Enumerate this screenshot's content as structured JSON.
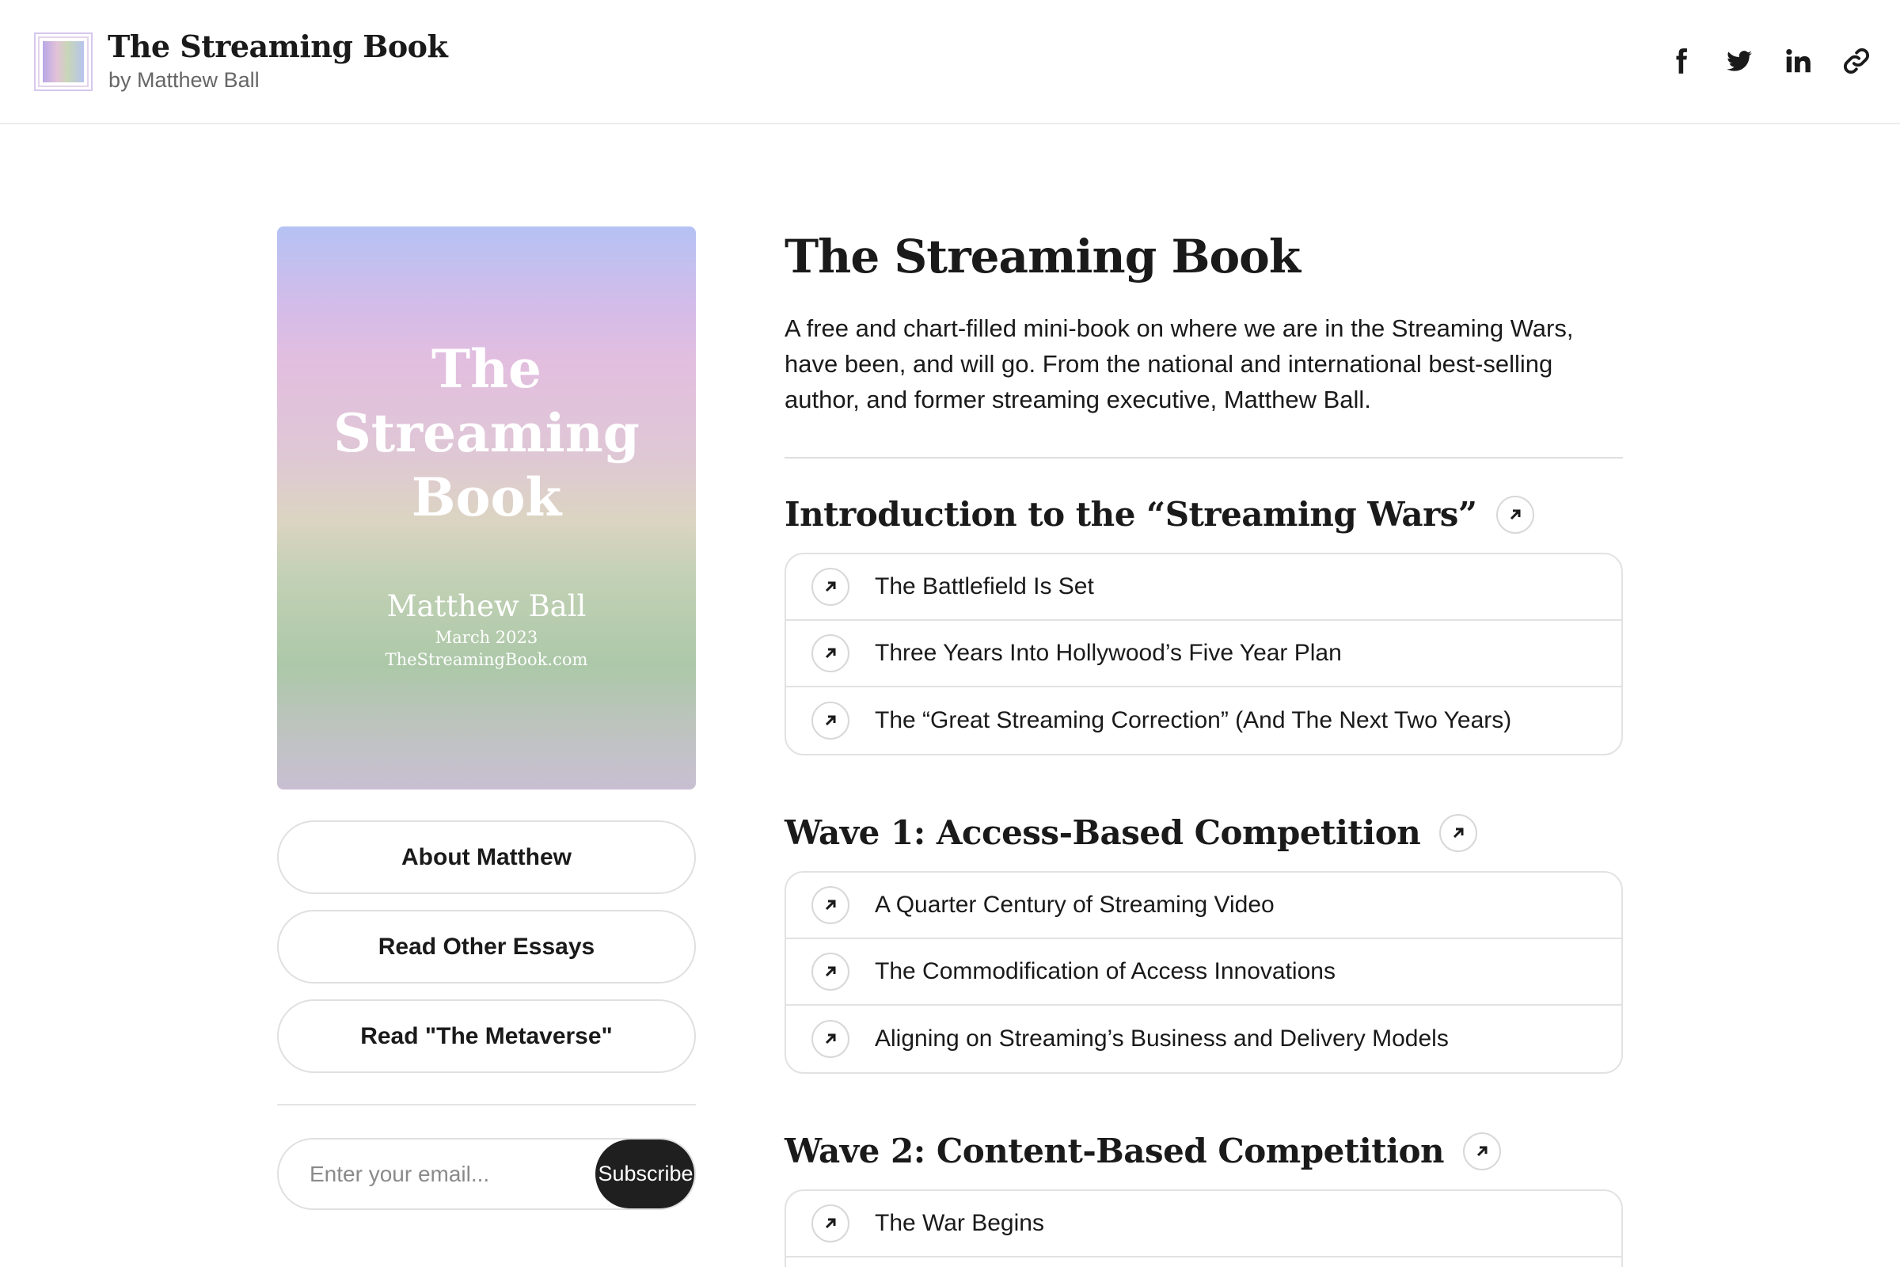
{
  "header": {
    "site_title": "The Streaming Book",
    "site_subtitle": "by Matthew Ball",
    "social_icons": [
      "facebook-icon",
      "twitter-icon",
      "linkedin-icon",
      "link-icon"
    ]
  },
  "cover": {
    "title_lines": [
      "The",
      "Streaming",
      "Book"
    ],
    "author": "Matthew Ball",
    "date": "March 2023",
    "url": "TheStreamingBook.com"
  },
  "sidebar": {
    "buttons": [
      "About Matthew",
      "Read Other Essays",
      "Read \"The Metaverse\""
    ],
    "email_placeholder": "Enter your email...",
    "subscribe_label": "Subscribe"
  },
  "main": {
    "title": "The Streaming Book",
    "description": "A free and chart-filled mini-book on where we are in the Streaming Wars, have been, and will go. From the national and international best-selling author, and former streaming executive, Matthew Ball.",
    "sections": [
      {
        "title": "Introduction to the “Streaming Wars”",
        "chapters": [
          "The Battlefield Is Set",
          "Three Years Into Hollywood’s Five Year Plan",
          "The “Great Streaming Correction” (And The Next Two Years)"
        ]
      },
      {
        "title": "Wave 1: Access-Based Competition",
        "chapters": [
          "A Quarter Century of Streaming Video",
          "The Commodification of Access Innovations",
          "Aligning on Streaming’s Business and Delivery Models"
        ]
      },
      {
        "title": "Wave 2: Content-Based Competition",
        "chapters": [
          "The War Begins"
        ]
      }
    ]
  },
  "colors": {
    "text": "#1a1a1a",
    "border": "#e2e2e2",
    "subscribe_bg": "#1f1f1f"
  }
}
